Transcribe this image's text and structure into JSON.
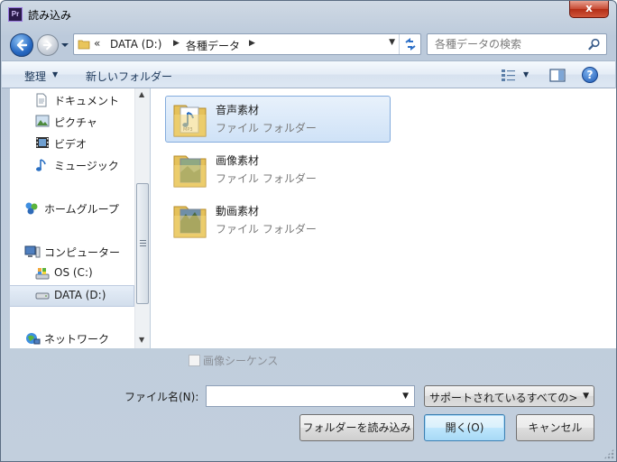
{
  "window": {
    "title": "読み込み",
    "app_badge": "Pr"
  },
  "address_bar": {
    "overflow": "«",
    "crumbs": [
      "DATA (D:)",
      "各種データ"
    ]
  },
  "search": {
    "placeholder": "各種データの検索"
  },
  "command_bar": {
    "organize": "整理",
    "new_folder": "新しいフォルダー",
    "help": "?"
  },
  "nav_pane": {
    "items": [
      {
        "label": "ドキュメント",
        "icon": "document-icon"
      },
      {
        "label": "ピクチャ",
        "icon": "picture-icon"
      },
      {
        "label": "ビデオ",
        "icon": "video-icon"
      },
      {
        "label": "ミュージック",
        "icon": "music-icon"
      },
      {
        "label": "ホームグループ",
        "icon": "homegroup-icon"
      },
      {
        "label": "コンピューター",
        "icon": "computer-icon"
      },
      {
        "label": "OS (C:)",
        "icon": "system-drive-icon"
      },
      {
        "label": "DATA (D:)",
        "icon": "drive-icon",
        "selected": true
      },
      {
        "label": "ネットワーク",
        "icon": "network-icon"
      }
    ]
  },
  "files": [
    {
      "name": "音声素材",
      "type": "ファイル フォルダー",
      "icon": "audio-folder-icon",
      "selected": true
    },
    {
      "name": "画像素材",
      "type": "ファイル フォルダー",
      "icon": "image-folder-icon"
    },
    {
      "name": "動画素材",
      "type": "ファイル フォルダー",
      "icon": "video-folder-icon"
    }
  ],
  "options": {
    "image_sequence": "画像シーケンス"
  },
  "filename": {
    "label": "ファイル名(N):",
    "value": ""
  },
  "filter": {
    "value": "サポートされているすべての>"
  },
  "buttons": {
    "import_folder": "フォルダーを読み込み",
    "open": "開く(O)",
    "cancel": "キャンセル"
  },
  "title_controls": {
    "close": "x"
  },
  "colors": {
    "selection": "#cfe2f7",
    "selection_border": "#84acdd",
    "close": "#c74a33"
  }
}
